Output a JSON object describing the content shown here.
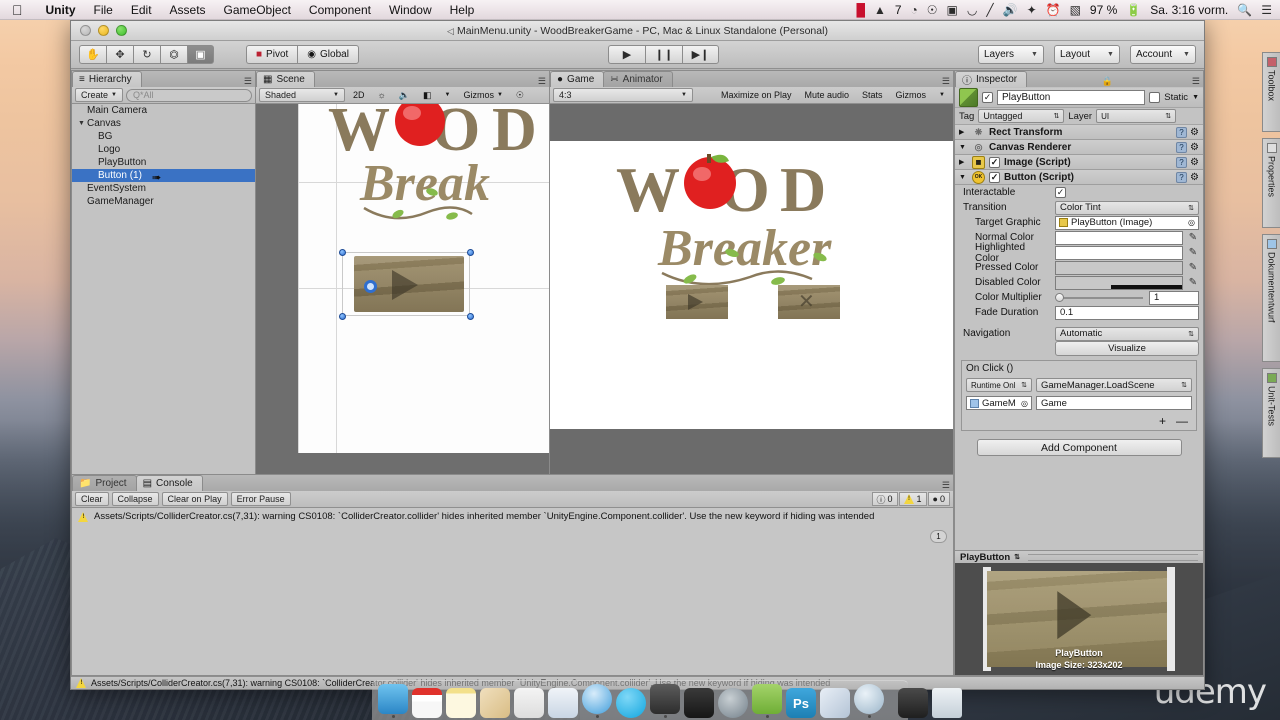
{
  "menubar": {
    "apple": "apple-logo",
    "items": [
      "Unity",
      "File",
      "Edit",
      "Assets",
      "GameObject",
      "Component",
      "Window",
      "Help"
    ],
    "status_icons": [
      "adobe-cc-icon",
      "adobe-icon",
      "dropbox-icon",
      "display-icon",
      "wifi-icon",
      "pencil-icon",
      "volume-icon",
      "bluetooth-icon",
      "timemachine-icon",
      "flag-icon"
    ],
    "adobe_badge": "7",
    "battery": "97 %",
    "battery_icon": "battery-charging-icon",
    "time": "Sa. 3:16 vorm.",
    "search_icon": "spotlight-search-icon",
    "notif_icon": "notification-center-icon"
  },
  "window": {
    "title": "MainMenu.unity - WoodBreakerGame - PC, Mac & Linux Standalone (Personal)",
    "lock_icon": "document-proxy-icon"
  },
  "toolbar": {
    "tools": [
      {
        "name": "hand-tool",
        "glyph": "✋"
      },
      {
        "name": "move-tool",
        "glyph": "✥"
      },
      {
        "name": "rotate-tool",
        "glyph": "⟳"
      },
      {
        "name": "scale-tool",
        "glyph": "⤧"
      },
      {
        "name": "rect-tool",
        "glyph": "▣"
      }
    ],
    "active_tool_index": 4,
    "pivot_label": "Pivot",
    "global_label": "Global",
    "play_label": "▶",
    "pause_label": "❙❙",
    "step_label": "▶❙",
    "layers_label": "Layers",
    "layout_label": "Layout",
    "account_label": "Account"
  },
  "hierarchy": {
    "tab": "Hierarchy",
    "create_label": "Create",
    "search_placeholder": "Q*All",
    "items": [
      {
        "label": "Main Camera",
        "depth": 1,
        "fold": "",
        "selected": false
      },
      {
        "label": "Canvas",
        "depth": 0,
        "fold": "▼",
        "selected": false
      },
      {
        "label": "BG",
        "depth": 2,
        "fold": "",
        "selected": false
      },
      {
        "label": "Logo",
        "depth": 2,
        "fold": "",
        "selected": false
      },
      {
        "label": "PlayButton",
        "depth": 2,
        "fold": "",
        "selected": false
      },
      {
        "label": "Button (1)",
        "depth": 2,
        "fold": "",
        "selected": true
      },
      {
        "label": "EventSystem",
        "depth": 1,
        "fold": "",
        "selected": false
      },
      {
        "label": "GameManager",
        "depth": 1,
        "fold": "",
        "selected": false
      }
    ]
  },
  "scene": {
    "tab": "Scene",
    "shading_mode": "Shaded",
    "mode_2d": "2D",
    "lighting_icon": "lighting-icon",
    "audio_icon": "audio-icon",
    "effects_icon": "effects-icon",
    "gizmos_label": "Gizmos",
    "scene_search_icon": "search-icon",
    "logo_line1": "WOOD",
    "logo_line2": "Breaker"
  },
  "game": {
    "tab": "Game",
    "animator_tab": "Animator",
    "aspect": "4:3",
    "maximize_on_play": "Maximize on Play",
    "mute_audio": "Mute audio",
    "stats": "Stats",
    "gizmos": "Gizmos",
    "logo_line1": "WOOD",
    "logo_line2": "Breaker"
  },
  "console": {
    "project_tab": "Project",
    "console_tab": "Console",
    "clear": "Clear",
    "collapse": "Collapse",
    "clear_on_play": "Clear on Play",
    "error_pause": "Error Pause",
    "log_message": "Assets/Scripts/ColliderCreator.cs(7,31): warning CS0108: `ColliderCreator.collider' hides inherited member `UnityEngine.Component.collider'. Use the new keyword if hiding was intended",
    "counts": {
      "info": "0",
      "warning": "1",
      "error": "0"
    },
    "collapse_badge": "1"
  },
  "inspector": {
    "tab": "Inspector",
    "lock_icon": "lock-icon",
    "object_name": "PlayButton",
    "enabled": true,
    "static_label": "Static",
    "tag_label": "Tag",
    "tag_value": "Untagged",
    "layer_label": "Layer",
    "layer_value": "UI",
    "components": [
      {
        "name": "Rect Transform",
        "fold": "▶",
        "icon": "rect-transform-icon",
        "has_checkbox": false
      },
      {
        "name": "Canvas Renderer",
        "fold": "▼",
        "icon": "canvas-renderer-icon",
        "has_checkbox": false
      },
      {
        "name": "Image (Script)",
        "fold": "▶",
        "icon": "image-script-icon",
        "has_checkbox": true
      },
      {
        "name": "Button (Script)",
        "fold": "▼",
        "icon": "button-script-icon",
        "has_checkbox": true
      }
    ],
    "button_script": {
      "interactable_label": "Interactable",
      "interactable": true,
      "transition_label": "Transition",
      "transition_value": "Color Tint",
      "target_graphic_label": "Target Graphic",
      "target_graphic_value": "PlayButton (Image)",
      "normal_color_label": "Normal Color",
      "highlighted_color_label": "Highlighted Color",
      "pressed_color_label": "Pressed Color",
      "disabled_color_label": "Disabled Color",
      "color_multiplier_label": "Color Multiplier",
      "color_multiplier_value": "1",
      "fade_duration_label": "Fade Duration",
      "fade_duration_value": "0.1",
      "navigation_label": "Navigation",
      "navigation_value": "Automatic",
      "visualize_label": "Visualize"
    },
    "on_click": {
      "title": "On Click ()",
      "runtime_value": "Runtime Onl",
      "function_value": "GameManager.LoadScene",
      "object_value": "GameM",
      "argument_value": "Game",
      "add_label": "+",
      "remove_label": "—"
    },
    "add_component_label": "Add Component"
  },
  "preview": {
    "title": "PlayButton",
    "caption_name": "PlayButton",
    "caption_size": "Image Size: 323x202"
  },
  "statusbar": {
    "message": "Assets/Scripts/ColliderCreator.cs(7,31): warning CS0108: `ColliderCreator.collider' hides inherited member `UnityEngine.Component.collider'. Use the new keyword if hiding was intended"
  },
  "dock_tabs": [
    {
      "label": "Toolbox",
      "icon": "toolbox-icon",
      "color": "#c4606a"
    },
    {
      "label": "Properties",
      "icon": "properties-icon",
      "color": "#c9c9c9"
    },
    {
      "label": "Dokumententwurf",
      "icon": "document-icon",
      "color": "#9ec5e8"
    },
    {
      "label": "Unit-Tests",
      "icon": "unit-tests-icon",
      "color": "#7aaa55"
    }
  ],
  "dock": {
    "apps": [
      {
        "name": "finder-icon",
        "color": "#3fa2e0",
        "running": true
      },
      {
        "name": "calendar-icon",
        "color": "#ffffff",
        "running": false
      },
      {
        "name": "notes-icon",
        "color": "#f7e9a8",
        "running": false
      },
      {
        "name": "keynote-icon",
        "color": "#efe0c3",
        "running": false
      },
      {
        "name": "numbers-icon",
        "color": "#e8e8e8",
        "running": false
      },
      {
        "name": "mail-icon",
        "color": "#dfe7ef",
        "running": false
      },
      {
        "name": "safari-icon",
        "color": "#5bb7e8",
        "running": true
      },
      {
        "name": "skype-icon",
        "color": "#20b8ec",
        "running": false
      },
      {
        "name": "unity-icon",
        "color": "#3c3c3c",
        "running": true
      },
      {
        "name": "terminal-icon",
        "color": "#2b2b2b",
        "running": false
      },
      {
        "name": "monodevelop-icon",
        "color": "#9aa3a8",
        "running": false
      },
      {
        "name": "evernote-icon",
        "color": "#8ec549",
        "running": true
      },
      {
        "name": "photoshop-icon",
        "color": "#2a9fd6",
        "running": false
      },
      {
        "name": "preview-icon",
        "color": "#cfd8e5",
        "running": false
      },
      {
        "name": "recordit-icon",
        "color": "#c8d8e2",
        "running": true
      },
      {
        "name": "screenflow-icon",
        "color": "#3a3a3a",
        "running": false
      },
      {
        "name": "trash-icon",
        "color": "#e0e6ea",
        "running": false
      }
    ]
  },
  "watermark": "udemy",
  "colors": {
    "selection_blue": "#3a72c4",
    "warning_yellow": "#f3d63f",
    "unity_panel": "#c3c3c3"
  }
}
